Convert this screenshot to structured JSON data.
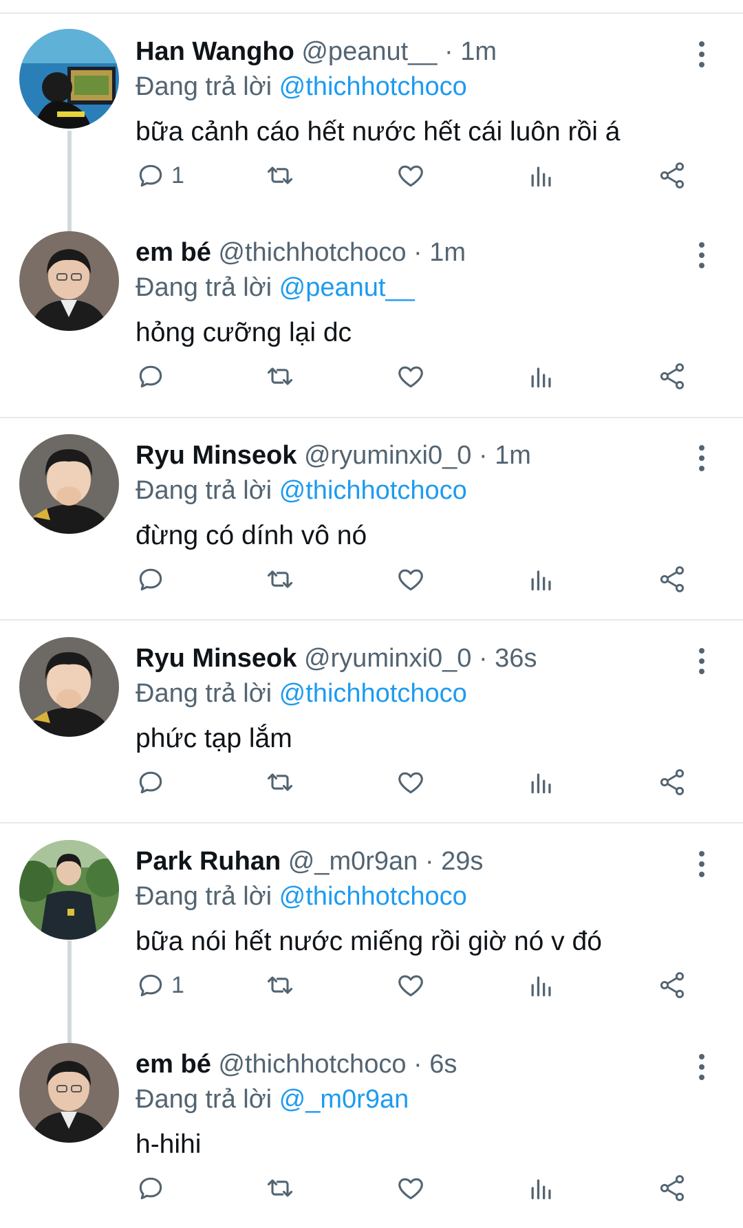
{
  "replying_label": "Đang trả lời",
  "tweets": [
    {
      "name": "Han Wangho",
      "handle": "@peanut__",
      "dot": "·",
      "time": "1m",
      "reply_to": "@thichhotchoco",
      "text": "bữa cảnh cáo hết nước hết cái luôn rồi á",
      "reply_count": "1"
    },
    {
      "name": "em bé",
      "handle": "@thichhotchoco",
      "dot": "·",
      "time": "1m",
      "reply_to": "@peanut__",
      "text": "hỏng cưỡng lại dc",
      "reply_count": ""
    },
    {
      "name": "Ryu Minseok",
      "handle": "@ryuminxi0_0",
      "dot": "·",
      "time": "1m",
      "reply_to": "@thichhotchoco",
      "text": "đừng có dính vô nó",
      "reply_count": ""
    },
    {
      "name": "Ryu Minseok",
      "handle": "@ryuminxi0_0",
      "dot": "·",
      "time": "36s",
      "reply_to": "@thichhotchoco",
      "text": "phức tạp lắm",
      "reply_count": ""
    },
    {
      "name": "Park Ruhan",
      "handle": "@_m0r9an",
      "dot": "·",
      "time": "29s",
      "reply_to": "@thichhotchoco",
      "text": "bữa nói hết nước miếng rồi giờ nó v đó",
      "reply_count": "1"
    },
    {
      "name": "em bé",
      "handle": "@thichhotchoco",
      "dot": "·",
      "time": "6s",
      "reply_to": "@_m0r9an",
      "text": "h-hihi",
      "reply_count": ""
    }
  ],
  "icons": {
    "reply": "reply-icon",
    "retweet": "retweet-icon",
    "like": "heart-icon",
    "views": "views-icon",
    "share": "share-icon",
    "more": "more-icon"
  },
  "colors": {
    "mention": "#1d9bf0",
    "secondary": "#536471",
    "text": "#0f1419"
  }
}
